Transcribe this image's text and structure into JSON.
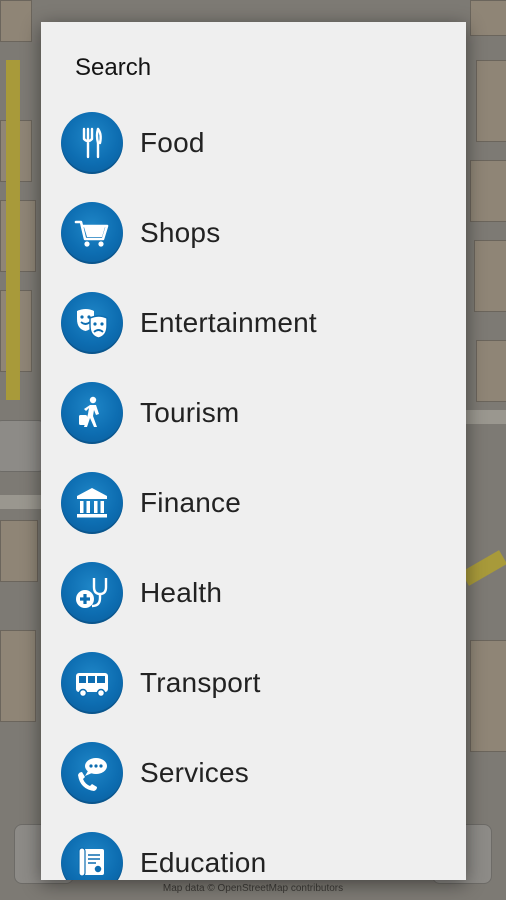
{
  "map": {
    "attribution": "Map data © OpenStreetMap contributors"
  },
  "dialog": {
    "title": "Search",
    "categories": [
      {
        "label": "Food",
        "icon": "fork-knife-icon"
      },
      {
        "label": "Shops",
        "icon": "shopping-cart-icon"
      },
      {
        "label": "Entertainment",
        "icon": "theater-masks-icon"
      },
      {
        "label": "Tourism",
        "icon": "traveler-luggage-icon"
      },
      {
        "label": "Finance",
        "icon": "bank-icon"
      },
      {
        "label": "Health",
        "icon": "stethoscope-icon"
      },
      {
        "label": "Transport",
        "icon": "bus-icon"
      },
      {
        "label": "Services",
        "icon": "phone-chat-icon"
      },
      {
        "label": "Education",
        "icon": "diploma-icon"
      }
    ]
  },
  "colors": {
    "icon_blue": "#0d6db1",
    "dialog_bg": "#efefef"
  }
}
